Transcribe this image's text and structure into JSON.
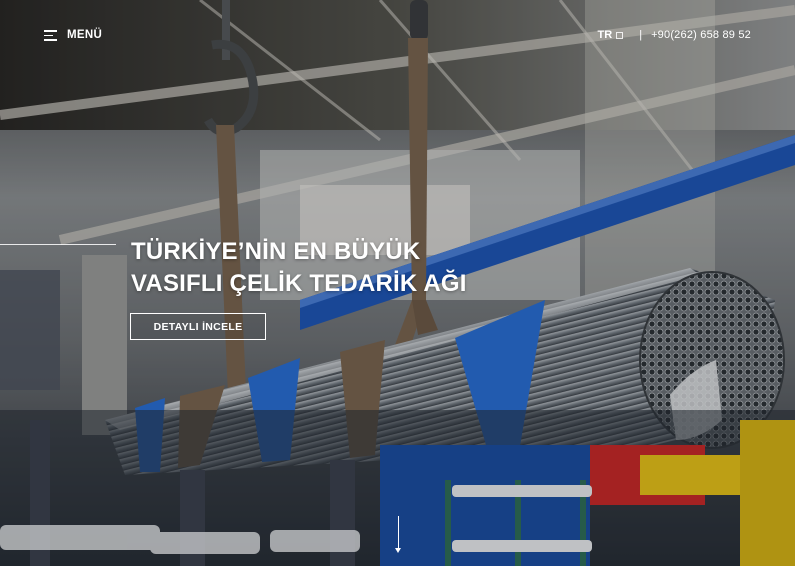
{
  "header": {
    "menu_label": "MENÜ",
    "language": "TR",
    "separator": "|",
    "phone": "+90(262) 658 89 52"
  },
  "hero": {
    "title_line1": "TÜRKİYE’NİN EN BÜYÜK",
    "title_line2": "VASIFLI ÇELİK TEDARİK AĞI",
    "cta_label": "DETAYLI İNCELE"
  },
  "icons": {
    "menu": "hamburger-icon",
    "language": "square-icon",
    "scroll": "arrow-down-icon"
  },
  "colors": {
    "text": "#ffffff",
    "beam_blue": "#1f57b8",
    "strap_blue": "#2a6fd6",
    "machine_yellow": "#e7c21a",
    "machine_red": "#c92a2a"
  }
}
